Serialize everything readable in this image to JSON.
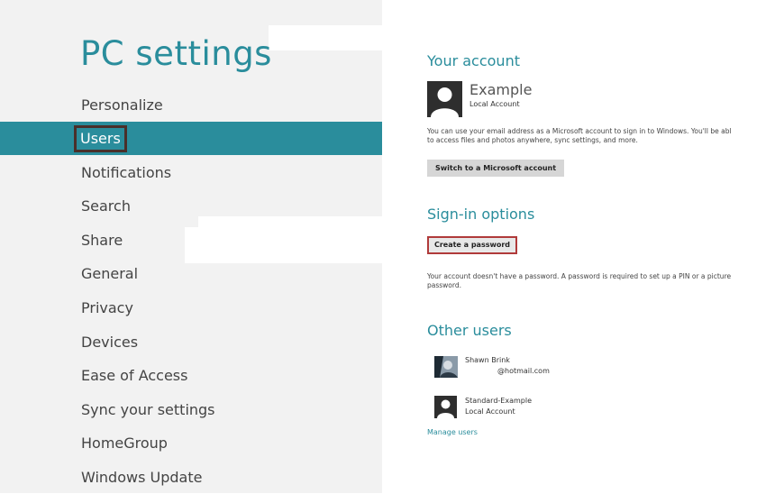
{
  "left": {
    "title": "PC settings",
    "items": [
      {
        "label": "Personalize"
      },
      {
        "label": "Users"
      },
      {
        "label": "Notifications"
      },
      {
        "label": "Search"
      },
      {
        "label": "Share"
      },
      {
        "label": "General"
      },
      {
        "label": "Privacy"
      },
      {
        "label": "Devices"
      },
      {
        "label": "Ease of Access"
      },
      {
        "label": "Sync your settings"
      },
      {
        "label": "HomeGroup"
      },
      {
        "label": "Windows Update"
      }
    ],
    "selected_index": 1
  },
  "account": {
    "heading": "Your account",
    "name": "Example",
    "type": "Local Account",
    "description_line1": "You can use your email address as a Microsoft account to sign in to Windows. You'll be abl",
    "description_line2": "to access files and photos anywhere, sync settings, and more.",
    "switch_button": "Switch to a Microsoft account"
  },
  "signin": {
    "heading": "Sign-in options",
    "create_password_button": "Create a password",
    "note_line1": "Your account doesn't have a password. A password is required to set up a PIN or a picture",
    "note_line2": "password."
  },
  "other_users": {
    "heading": "Other users",
    "users": [
      {
        "name": "Shawn Brink",
        "detail": "@hotmail.com"
      },
      {
        "name": "Standard-Example",
        "detail": "Local Account"
      }
    ],
    "manage_link": "Manage users"
  },
  "colors": {
    "accent": "#2a8d9c",
    "left_background": "#f2f2f2",
    "highlight_outline": "#b03a3a"
  },
  "icons": {
    "avatar": "user-silhouette-icon",
    "photo_avatar": "user-photo-icon"
  }
}
